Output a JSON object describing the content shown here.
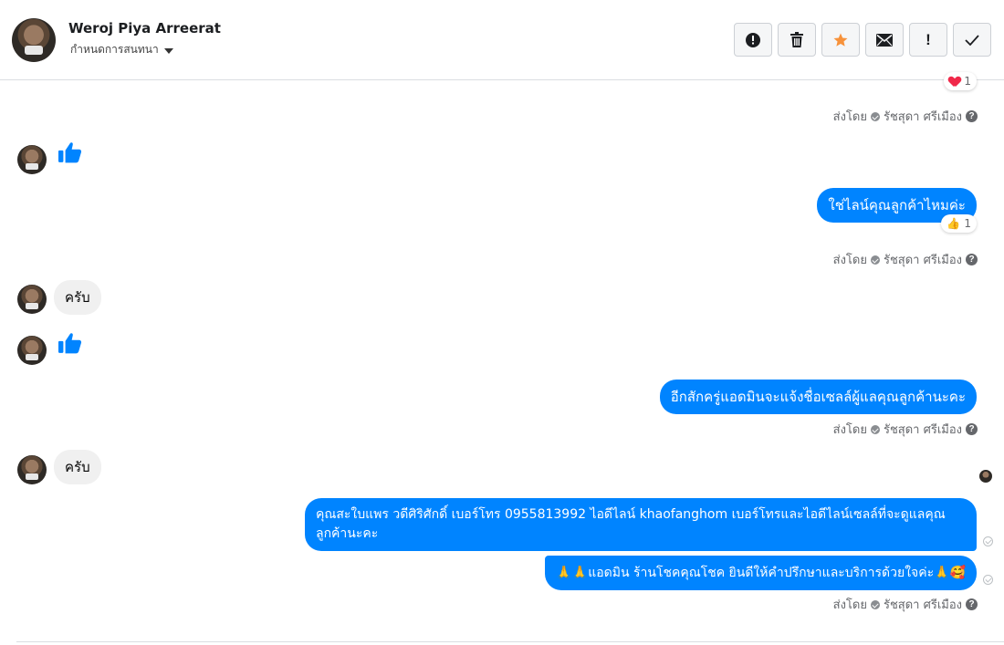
{
  "header": {
    "contact_name": "Weroj Piya Arreerat",
    "conversation_label": "กำหนดการสนทนา",
    "toolbar": [
      {
        "name": "report-spam-button",
        "icon": "alert-circle-icon"
      },
      {
        "name": "delete-button",
        "icon": "trash-icon"
      },
      {
        "name": "star-button",
        "icon": "star-icon",
        "color": "#f7923b"
      },
      {
        "name": "mark-unread-button",
        "icon": "envelope-icon"
      },
      {
        "name": "follow-up-button",
        "icon": "exclamation-icon",
        "label": "!"
      },
      {
        "name": "mark-done-button",
        "icon": "checkmark-icon"
      }
    ]
  },
  "thread": {
    "sent_by_prefix": "ส่งโดย",
    "sent_by_name": "รัชสุดา ศรีเมือง",
    "help_glyph": "?",
    "reaction_top_count": "1",
    "messages": [
      {
        "direction": "in",
        "type": "like",
        "icon": "thumbs-up-icon"
      },
      {
        "direction": "out",
        "text": "ใช่ไลน์คุณลูกค้าไหมค่ะ",
        "reaction": {
          "emoji": "👍",
          "count": "1"
        }
      },
      {
        "direction": "in",
        "text": "ครับ"
      },
      {
        "direction": "in",
        "type": "like",
        "icon": "thumbs-up-icon"
      },
      {
        "direction": "out",
        "text": "อีกสักครู่แอดมินจะแจ้งชื่อเซลล์ผู้แลคุณลูกค้านะคะ"
      },
      {
        "direction": "in",
        "text": "ครับ"
      },
      {
        "direction": "out",
        "text": "คุณสะใบแพร วดีศิริศักดิ์ เบอร์โทร 0955813992  ไอดีไลน์  khaofanghom  เบอร์โทรและไอดีไลน์เซลล์ที่จะดูแลคุณลูกค้านะคะ"
      },
      {
        "direction": "out",
        "text": "🙏🙏แอดมิน ร้านโชคคุณโชค ยินดีให้คำปรึกษาและบริการด้วยใจค่ะ🙏🥰"
      }
    ]
  },
  "colors": {
    "outgoing_bubble": "#0084ff",
    "incoming_bubble": "#f0f0f0",
    "like_blue": "#0084ff"
  }
}
